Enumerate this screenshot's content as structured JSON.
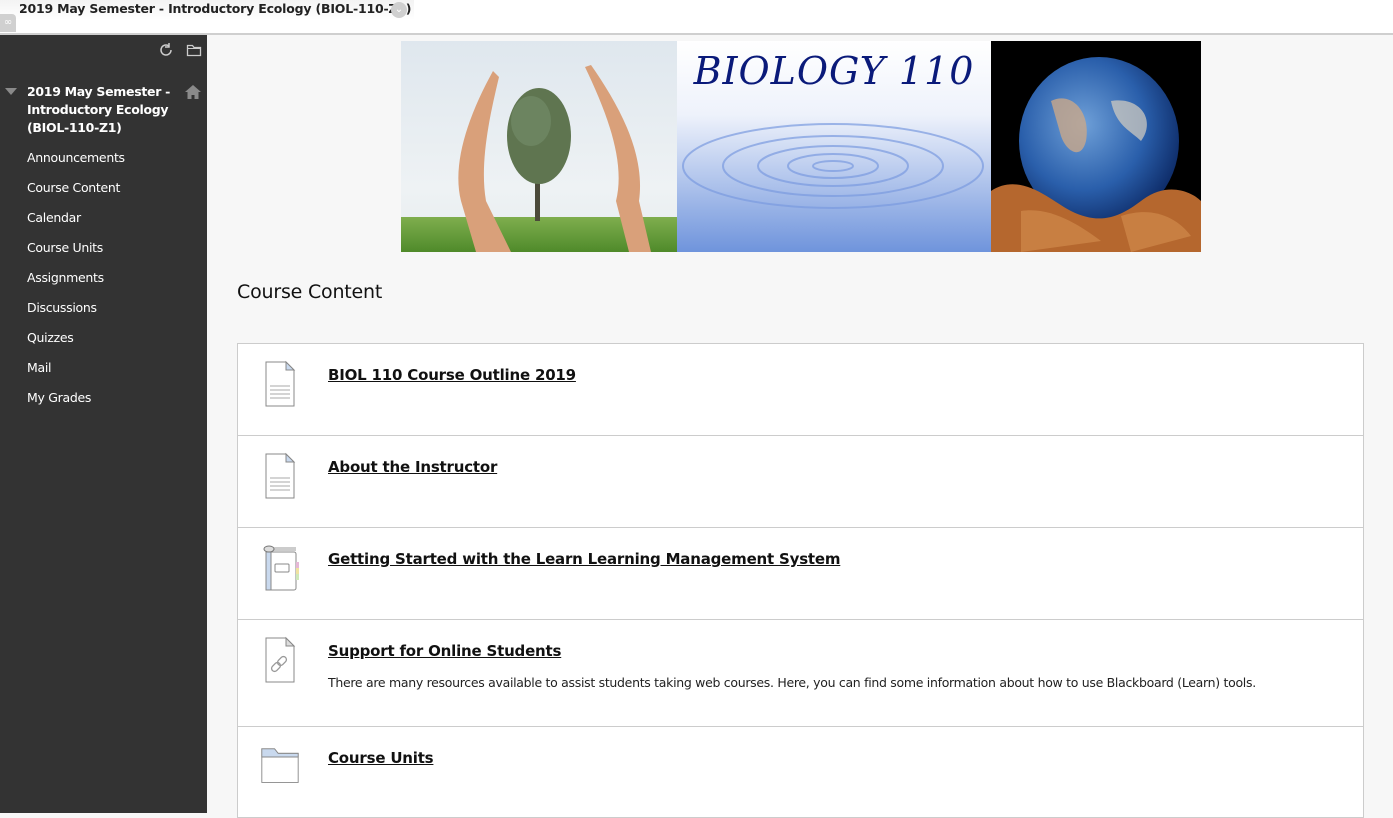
{
  "window": {
    "course_tab_title": "2019 May Semester - Introductory Ecology (BIOL-110-Z1)"
  },
  "sidebar": {
    "course_name": "2019 May Semester - Introductory Ecology (BIOL-110-Z1)",
    "tools": [
      "refresh-icon",
      "folder-view-icon"
    ],
    "items": [
      {
        "label": "Announcements"
      },
      {
        "label": "Course Content"
      },
      {
        "label": "Calendar"
      },
      {
        "label": "Course Units"
      },
      {
        "label": "Assignments"
      },
      {
        "label": "Discussions"
      },
      {
        "label": "Quizzes"
      },
      {
        "label": "Mail"
      },
      {
        "label": "My Grades"
      }
    ]
  },
  "banner": {
    "title": "BIOLOGY 110",
    "panels": [
      "hands-around-tree-image",
      "water-ripple-image",
      "earth-in-hands-image"
    ]
  },
  "main": {
    "page_title": "Course Content",
    "items": [
      {
        "title": "BIOL 110 Course Outline 2019",
        "icon": "document-icon",
        "description": ""
      },
      {
        "title": "About the Instructor",
        "icon": "document-icon",
        "description": ""
      },
      {
        "title": "Getting Started with the Learn Learning Management System",
        "icon": "notebook-icon",
        "description": ""
      },
      {
        "title": "Support for Online Students",
        "icon": "web-link-icon",
        "description": "There are many resources available to assist students taking web courses. Here, you can find some information about how to use Blackboard (Learn) tools."
      },
      {
        "title": "Course Units",
        "icon": "folder-icon",
        "description": ""
      }
    ]
  },
  "colors": {
    "sidebar_bg": "#333333",
    "page_bg": "#f7f7f7",
    "banner_title": "#0a1a7a",
    "border": "#cccccc"
  }
}
